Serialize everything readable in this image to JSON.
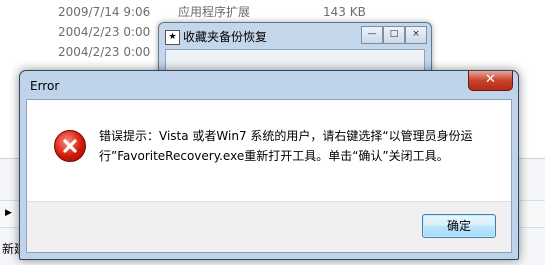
{
  "background": {
    "rows": [
      {
        "date": "2009/7/14 9:06",
        "type": "应用程序扩展",
        "size": "143 KB"
      },
      {
        "date": "2004/2/23 0:00",
        "type": "",
        "size": ""
      },
      {
        "date": "2004/2/23 0:00",
        "type": "",
        "size": ""
      }
    ],
    "status_text": "新建"
  },
  "behind_window": {
    "title": "收藏夹备份恢复",
    "buttons": [
      "—",
      "□",
      "×"
    ]
  },
  "dialog": {
    "title": "Error",
    "close_label": "✕",
    "message": "错误提示：Vista 或者Win7 系统的用户，请右键选择“以管理员身份运行”FavoriteRecovery.exe重新打开工具。单击“确认”关闭工具。",
    "ok_label": "确定",
    "icon": "error-icon"
  }
}
